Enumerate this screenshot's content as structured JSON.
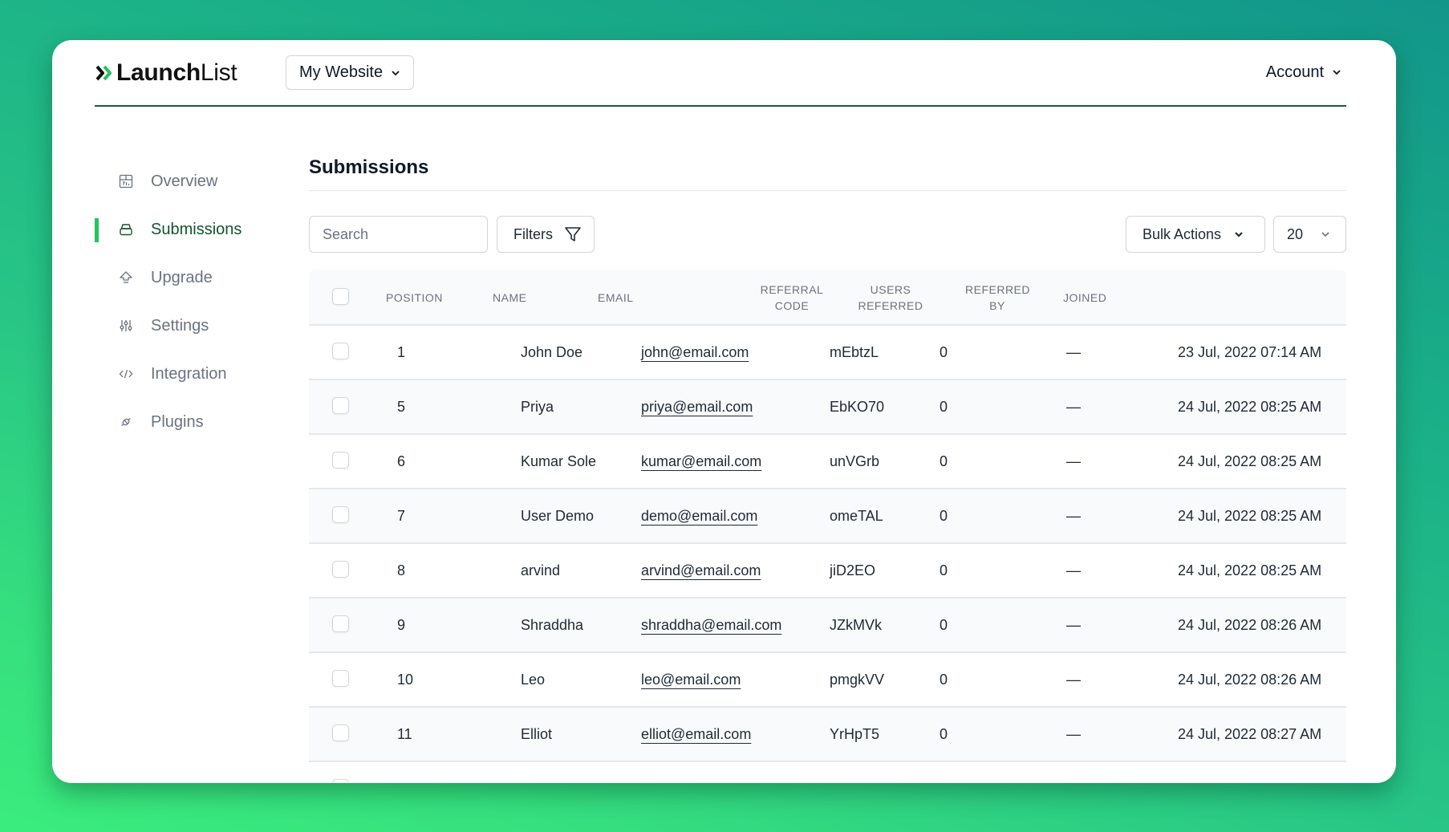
{
  "app": {
    "logo_bold": "Launch",
    "logo_light": "List",
    "accent_color": "#22c55e",
    "site_selector": "My Website",
    "account_label": "Account"
  },
  "sidebar": {
    "items": [
      {
        "label": "Overview",
        "icon": "calendar-chart-icon",
        "active": false
      },
      {
        "label": "Submissions",
        "icon": "inbox-tray-icon",
        "active": true
      },
      {
        "label": "Upgrade",
        "icon": "upgrade-arrow-icon",
        "active": false
      },
      {
        "label": "Settings",
        "icon": "sliders-icon",
        "active": false
      },
      {
        "label": "Integration",
        "icon": "code-icon",
        "active": false
      },
      {
        "label": "Plugins",
        "icon": "plug-icon",
        "active": false
      }
    ]
  },
  "main": {
    "title": "Submissions",
    "search_placeholder": "Search",
    "filters_label": "Filters",
    "bulk_actions_label": "Bulk Actions",
    "per_page": "20"
  },
  "table": {
    "headers": {
      "position": "Position",
      "name": "Name",
      "email": "Email",
      "referral_code": [
        "Referral",
        "Code"
      ],
      "users_referred": [
        "Users",
        "Referred"
      ],
      "referred_by": [
        "Referred",
        "By"
      ],
      "joined": "Joined"
    },
    "rows": [
      {
        "position": "1",
        "name": "John Doe",
        "email": "john@email.com",
        "code": "mEbtzL",
        "users": "0",
        "referred_by": "—",
        "joined": "23 Jul, 2022 07:14 AM"
      },
      {
        "position": "5",
        "name": "Priya",
        "email": "priya@email.com",
        "code": "EbKO70",
        "users": "0",
        "referred_by": "—",
        "joined": "24 Jul, 2022 08:25 AM"
      },
      {
        "position": "6",
        "name": "Kumar Sole",
        "email": "kumar@email.com",
        "code": "unVGrb",
        "users": "0",
        "referred_by": "—",
        "joined": "24 Jul, 2022 08:25 AM"
      },
      {
        "position": "7",
        "name": "User Demo",
        "email": "demo@email.com",
        "code": "omeTAL",
        "users": "0",
        "referred_by": "—",
        "joined": "24 Jul, 2022 08:25 AM"
      },
      {
        "position": "8",
        "name": "arvind",
        "email": "arvind@email.com",
        "code": "jiD2EO",
        "users": "0",
        "referred_by": "—",
        "joined": "24 Jul, 2022 08:25 AM"
      },
      {
        "position": "9",
        "name": "Shraddha",
        "email": "shraddha@email.com",
        "code": "JZkMVk",
        "users": "0",
        "referred_by": "—",
        "joined": "24 Jul, 2022 08:26 AM"
      },
      {
        "position": "10",
        "name": "Leo",
        "email": "leo@email.com",
        "code": "pmgkVV",
        "users": "0",
        "referred_by": "—",
        "joined": "24 Jul, 2022 08:26 AM"
      },
      {
        "position": "11",
        "name": "Elliot",
        "email": "elliot@email.com",
        "code": "YrHpT5",
        "users": "0",
        "referred_by": "—",
        "joined": "24 Jul, 2022 08:27 AM"
      }
    ]
  }
}
